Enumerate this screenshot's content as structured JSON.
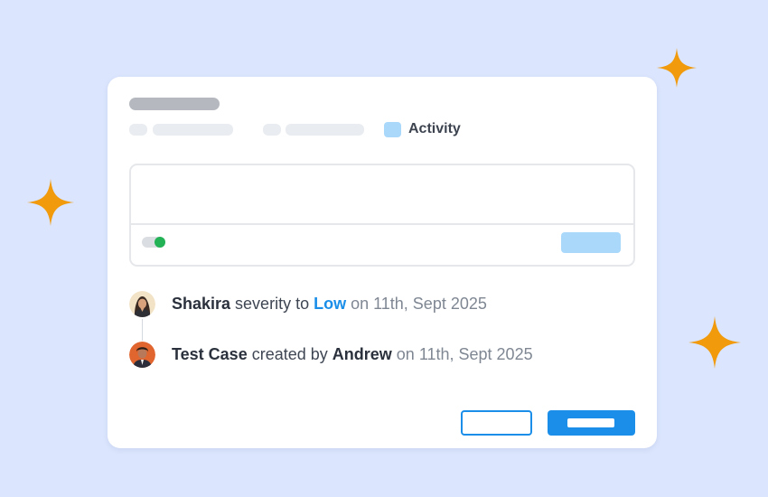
{
  "colors": {
    "background": "#dbe5fd",
    "accent": "#1a8ee8",
    "sparkle": "#f09a0c",
    "toggle_on": "#23b255"
  },
  "tabs": {
    "active_label": "Activity"
  },
  "activity": [
    {
      "avatar": "woman-avatar",
      "name": "Shakira",
      "action": " severity to ",
      "value": "Low",
      "date": " on 11th, Sept 2025"
    },
    {
      "avatar": "man-avatar",
      "subject": "Test Case",
      "action": " created by ",
      "name": "Andrew",
      "date": " on 11th, Sept 2025"
    }
  ],
  "icons": [
    "sparkle-icon",
    "toggle-icon",
    "avatar-icon"
  ]
}
